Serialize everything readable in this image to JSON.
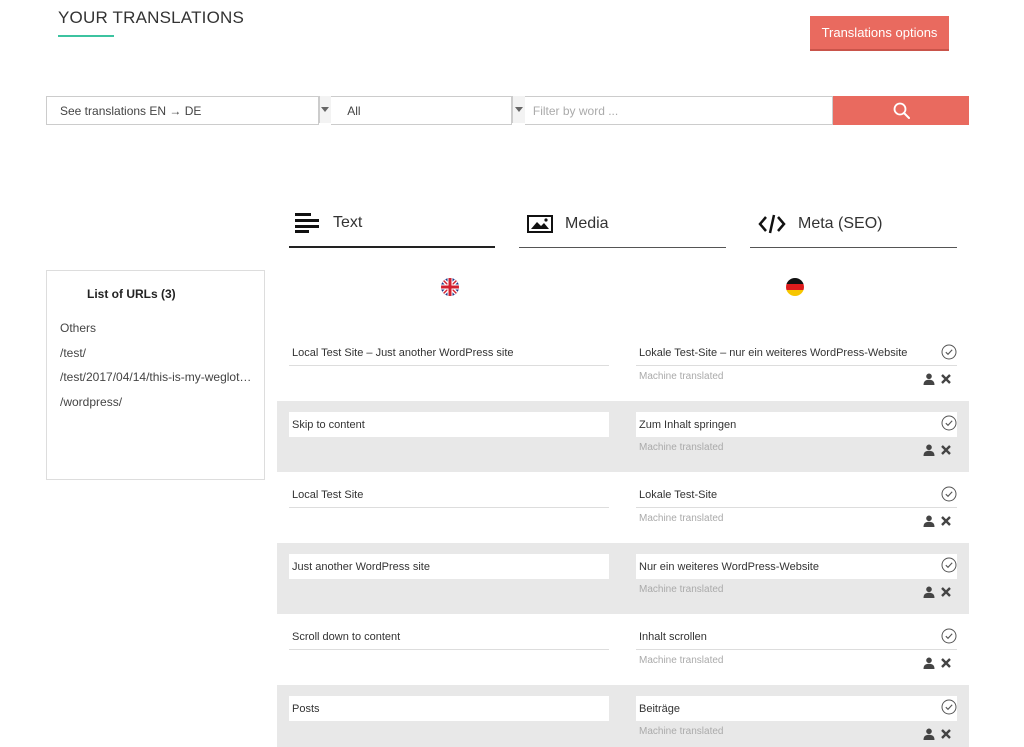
{
  "header": {
    "title": "YOUR TRANSLATIONS",
    "options_label": "Translations options"
  },
  "filters": {
    "language_pair": "See translations EN → DE",
    "type": "All",
    "word_placeholder": "Filter by word ..."
  },
  "tabs": [
    {
      "label": "Text",
      "icon": "text-lines-icon",
      "active": true
    },
    {
      "label": "Media",
      "icon": "image-icon",
      "active": false
    },
    {
      "label": "Meta (SEO)",
      "icon": "code-icon",
      "active": false
    }
  ],
  "urls": {
    "title": "List of URLs (3)",
    "items": [
      "Others",
      "/test/",
      "/test/2017/04/14/this-is-my-weglot…",
      "/wordpress/"
    ]
  },
  "languages": {
    "source": "uk-flag-icon",
    "target": "de-flag-icon"
  },
  "rows": [
    {
      "source": "Local Test Site – Just another WordPress site",
      "target": "Lokale Test-Site – nur ein weiteres WordPress-Website",
      "status": "Machine translated"
    },
    {
      "source": "Skip to content",
      "target": "Zum Inhalt springen",
      "status": "Machine translated"
    },
    {
      "source": "Local Test Site",
      "target": "Lokale Test-Site",
      "status": "Machine translated"
    },
    {
      "source": "Just another WordPress site",
      "target": "Nur ein weiteres WordPress-Website",
      "status": "Machine translated"
    },
    {
      "source": "Scroll down to content",
      "target": "Inhalt scrollen",
      "status": "Machine translated"
    },
    {
      "source": "Posts",
      "target": "Beiträge",
      "status": "Machine translated"
    }
  ],
  "colors": {
    "accent": "#e96a5f",
    "underline": "#3cc3a0",
    "row_alt": "#e8e8e8"
  }
}
